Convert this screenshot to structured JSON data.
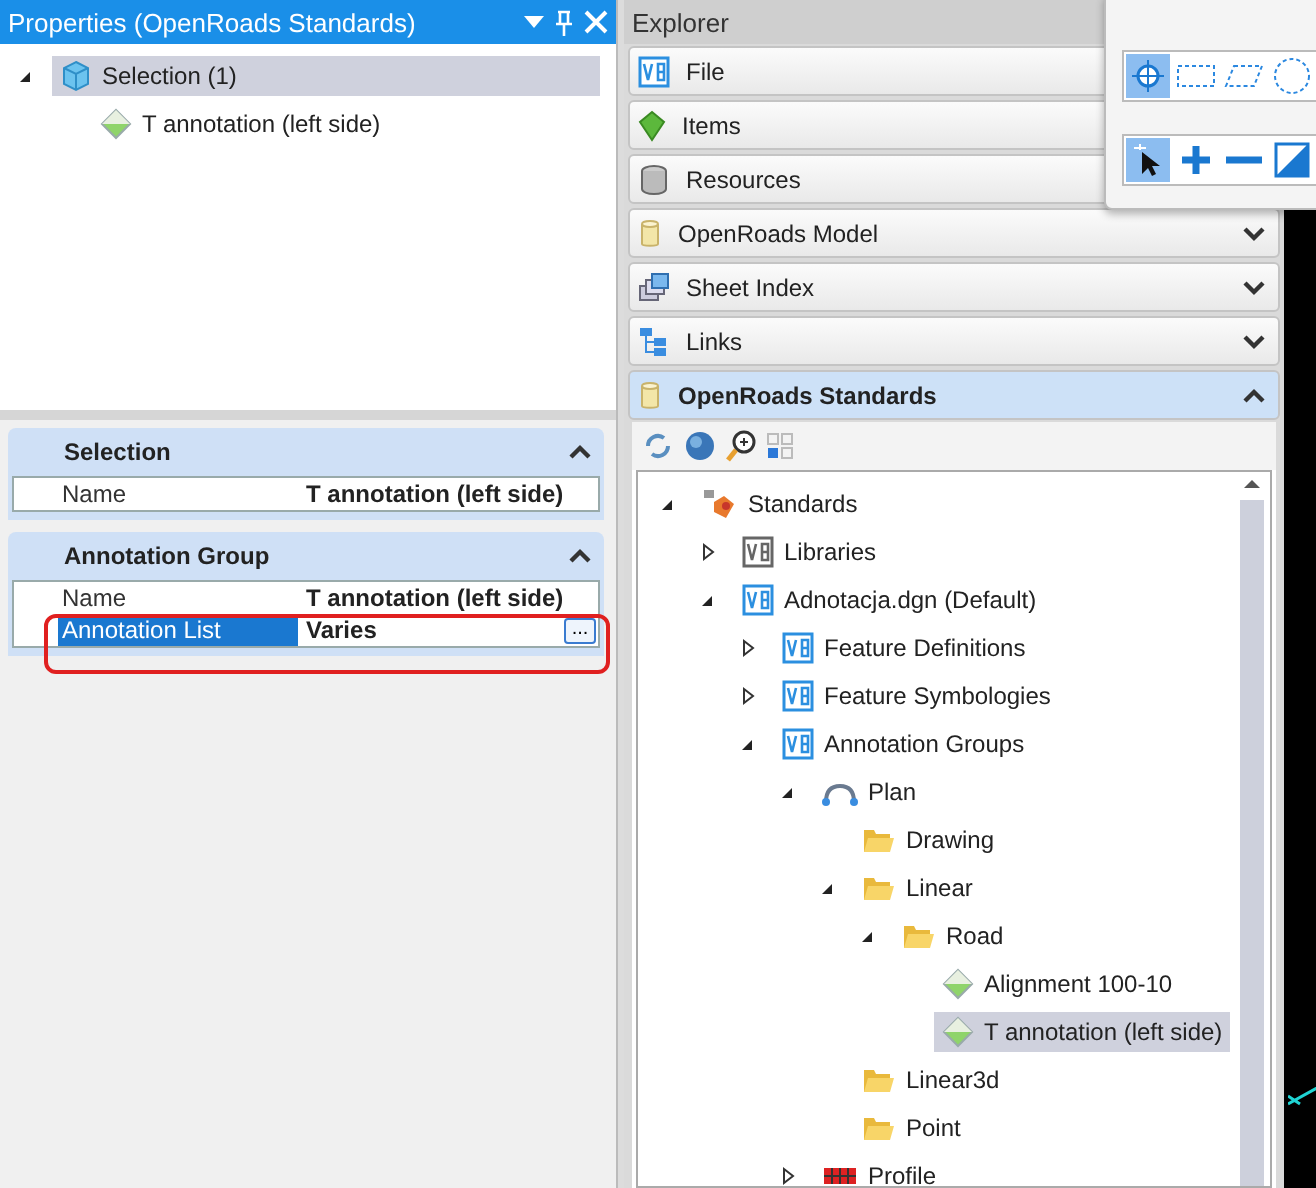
{
  "properties_panel": {
    "title": "Properties (OpenRoads Standards)",
    "tree": [
      {
        "label": "Selection (1)",
        "kind": "selection",
        "expanded": true,
        "selected": true,
        "children": [
          {
            "label": "T annotation (left side)",
            "kind": "feature",
            "selected": false
          }
        ]
      }
    ],
    "categories": [
      {
        "title": "Selection",
        "expanded": true,
        "rows": [
          {
            "name": "Name",
            "value": "T annotation (left side)",
            "selected": false
          }
        ]
      },
      {
        "title": "Annotation Group",
        "expanded": true,
        "rows": [
          {
            "name": "Name",
            "value": "T annotation (left side)",
            "selected": false
          },
          {
            "name": "Annotation List",
            "value": "Varies",
            "selected": true,
            "button": "..."
          }
        ]
      }
    ]
  },
  "explorer": {
    "title": "Explorer",
    "sections": [
      {
        "label": "File",
        "kind": "file",
        "expanded": false
      },
      {
        "label": "Items",
        "kind": "items",
        "expanded": false
      },
      {
        "label": "Resources",
        "kind": "resources",
        "expanded": false
      },
      {
        "label": "OpenRoads Model",
        "kind": "model",
        "expanded": false
      },
      {
        "label": "Sheet Index",
        "kind": "sheets",
        "expanded": false
      },
      {
        "label": "Links",
        "kind": "links",
        "expanded": false
      },
      {
        "label": "OpenRoads Standards",
        "kind": "model",
        "expanded": true
      }
    ],
    "tree": [
      {
        "label": "Standards",
        "kind": "standards",
        "expanded": true,
        "selected": false,
        "children": [
          {
            "label": "Libraries",
            "kind": "library",
            "expanded": false,
            "selected": false
          },
          {
            "label": "Adnotacja.dgn (Default)",
            "kind": "v8",
            "expanded": true,
            "selected": false,
            "children": [
              {
                "label": "Feature Definitions",
                "kind": "v8",
                "expanded": false,
                "selected": false
              },
              {
                "label": "Feature Symbologies",
                "kind": "v8",
                "expanded": false,
                "selected": false
              },
              {
                "label": "Annotation Groups",
                "kind": "v8",
                "expanded": true,
                "selected": false,
                "children": [
                  {
                    "label": "Plan",
                    "kind": "plan",
                    "expanded": true,
                    "selected": false,
                    "children": [
                      {
                        "label": "Drawing",
                        "kind": "folder",
                        "selected": false
                      },
                      {
                        "label": "Linear",
                        "kind": "folder",
                        "expanded": true,
                        "selected": false,
                        "children": [
                          {
                            "label": "Road",
                            "kind": "folder",
                            "expanded": true,
                            "selected": false,
                            "children": [
                              {
                                "label": "Alignment 100-10",
                                "kind": "feature",
                                "selected": false
                              },
                              {
                                "label": "T annotation (left side)",
                                "kind": "feature",
                                "selected": true
                              }
                            ]
                          }
                        ]
                      },
                      {
                        "label": "Linear3d",
                        "kind": "folder",
                        "selected": false
                      },
                      {
                        "label": "Point",
                        "kind": "folder",
                        "selected": false
                      }
                    ]
                  },
                  {
                    "label": "Profile",
                    "kind": "profile",
                    "expanded": false,
                    "selected": false
                  }
                ]
              }
            ]
          }
        ]
      }
    ]
  }
}
